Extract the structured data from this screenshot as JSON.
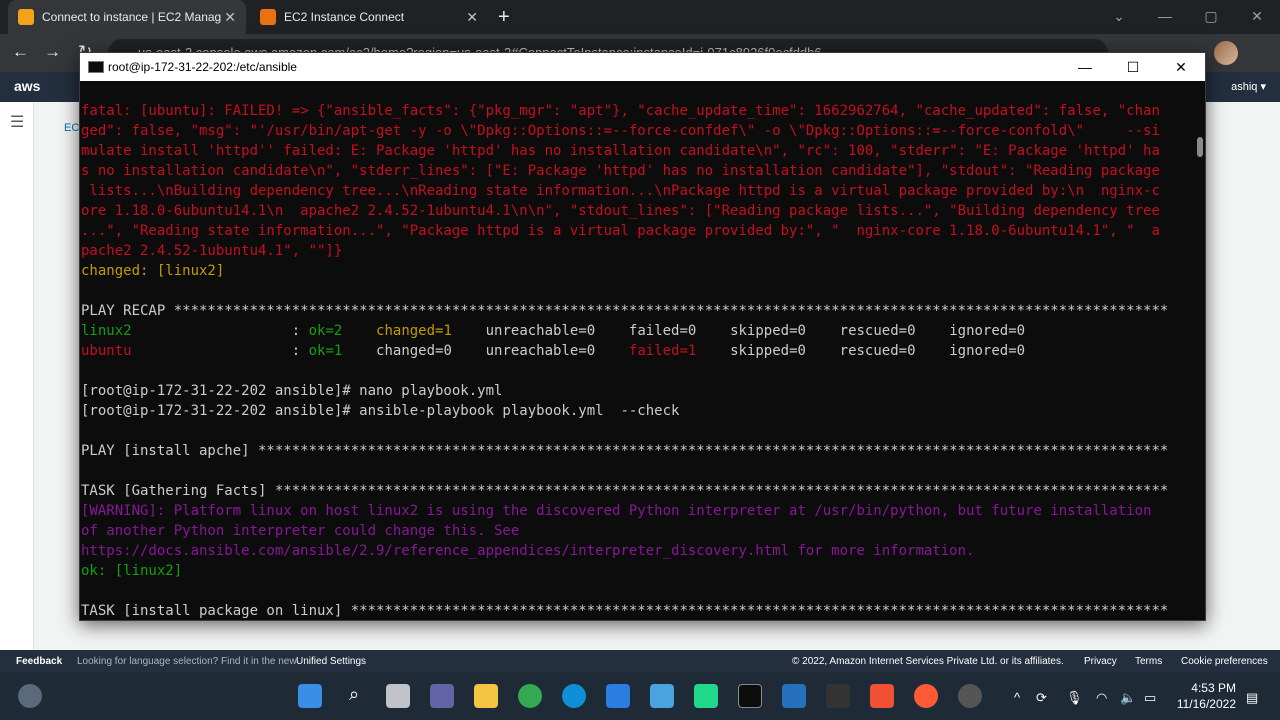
{
  "browser": {
    "tabs": [
      {
        "title": "Connect to instance | EC2 Manag",
        "fav_color": "#f1a41a"
      },
      {
        "title": "EC2 Instance Connect",
        "fav_color": "#ec7211"
      }
    ],
    "url": "us-east-2.console.aws.amazon.com/ec2/home?region=us-east-2#ConnectToInstance:instanceId=i-071c8926f0ecfddb6"
  },
  "aws": {
    "logo": "aws",
    "user": "ashiq ▾",
    "crumb": "EC"
  },
  "terminal": {
    "title": "root@ip-172-31-22-202:/etc/ansible",
    "lines": [
      {
        "color": "red",
        "text": "fatal: [ubuntu]: FAILED! => {\"ansible_facts\": {\"pkg_mgr\": \"apt\"}, \"cache_update_time\": 1662962764, \"cache_updated\": false, \"chan"
      },
      {
        "color": "red",
        "text": "ged\": false, \"msg\": \"'/usr/bin/apt-get -y -o \\\"Dpkg::Options::=--force-confdef\\\" -o \\\"Dpkg::Options::=--force-confold\\\"     --si"
      },
      {
        "color": "red",
        "text": "mulate install 'httpd'' failed: E: Package 'httpd' has no installation candidate\\n\", \"rc\": 100, \"stderr\": \"E: Package 'httpd' ha"
      },
      {
        "color": "red",
        "text": "s no installation candidate\\n\", \"stderr_lines\": [\"E: Package 'httpd' has no installation candidate\"], \"stdout\": \"Reading package"
      },
      {
        "color": "red",
        "text": " lists...\\nBuilding dependency tree...\\nReading state information...\\nPackage httpd is a virtual package provided by:\\n  nginx-c"
      },
      {
        "color": "red",
        "text": "ore 1.18.0-6ubuntu14.1\\n  apache2 2.4.52-1ubuntu4.1\\n\\n\", \"stdout_lines\": [\"Reading package lists...\", \"Building dependency tree"
      },
      {
        "color": "red",
        "text": "...\", \"Reading state information...\", \"Package httpd is a virtual package provided by:\", \"  nginx-core 1.18.0-6ubuntu14.1\", \"  a"
      },
      {
        "color": "red",
        "text": "pache2 2.4.52-1ubuntu4.1\", \"\"]}"
      },
      {
        "color": "yel",
        "text": "changed: [linux2]"
      },
      {
        "color": "wht",
        "text": ""
      },
      {
        "color": "wht",
        "text": "PLAY RECAP **********************************************************************************************************************"
      },
      {
        "color": "wht",
        "text": ""
      },
      {
        "color": "wht",
        "text": ""
      },
      {
        "color": "wht",
        "text": ""
      },
      {
        "color": "wht",
        "text": "[root@ip-172-31-22-202 ansible]# nano playbook.yml"
      },
      {
        "color": "wht",
        "text": "[root@ip-172-31-22-202 ansible]# ansible-playbook playbook.yml  --check"
      },
      {
        "color": "wht",
        "text": ""
      },
      {
        "color": "wht",
        "text": "PLAY [install apche] ************************************************************************************************************"
      },
      {
        "color": "wht",
        "text": ""
      },
      {
        "color": "wht",
        "text": "TASK [Gathering Facts] **********************************************************************************************************"
      },
      {
        "color": "mag",
        "text": "[WARNING]: Platform linux on host linux2 is using the discovered Python interpreter at /usr/bin/python, but future installation"
      },
      {
        "color": "mag",
        "text": "of another Python interpreter could change this. See"
      },
      {
        "color": "mag",
        "text": "https://docs.ansible.com/ansible/2.9/reference_appendices/interpreter_discovery.html for more information."
      },
      {
        "color": "grn",
        "text": "ok: [linux2]"
      },
      {
        "color": "wht",
        "text": ""
      },
      {
        "color": "wht",
        "text": "TASK [install package on linux] *************************************************************************************************"
      }
    ],
    "recap": [
      {
        "host": "linux2",
        "ok": "ok=2",
        "changed": "changed=1",
        "unreachable": "unreachable=0",
        "failed": "failed=0",
        "skipped": "skipped=0",
        "rescued": "rescued=0",
        "ignored": "ignored=0"
      },
      {
        "host": "ubuntu",
        "ok": "ok=1",
        "changed": "changed=0",
        "unreachable": "unreachable=0",
        "failed": "failed=1",
        "skipped": "skipped=0",
        "rescued": "rescued=0",
        "ignored": "ignored=0"
      }
    ]
  },
  "footer": {
    "feedback": "Feedback",
    "language_msg": "Looking for language selection? Find it in the new",
    "unified": "Unified Settings",
    "copyright": "© 2022, Amazon Internet Services Private Ltd. or its affiliates.",
    "privacy": "Privacy",
    "terms": "Terms",
    "cookie": "Cookie preferences"
  },
  "taskbar": {
    "time": "4:53 PM",
    "date": "11/16/2022"
  }
}
